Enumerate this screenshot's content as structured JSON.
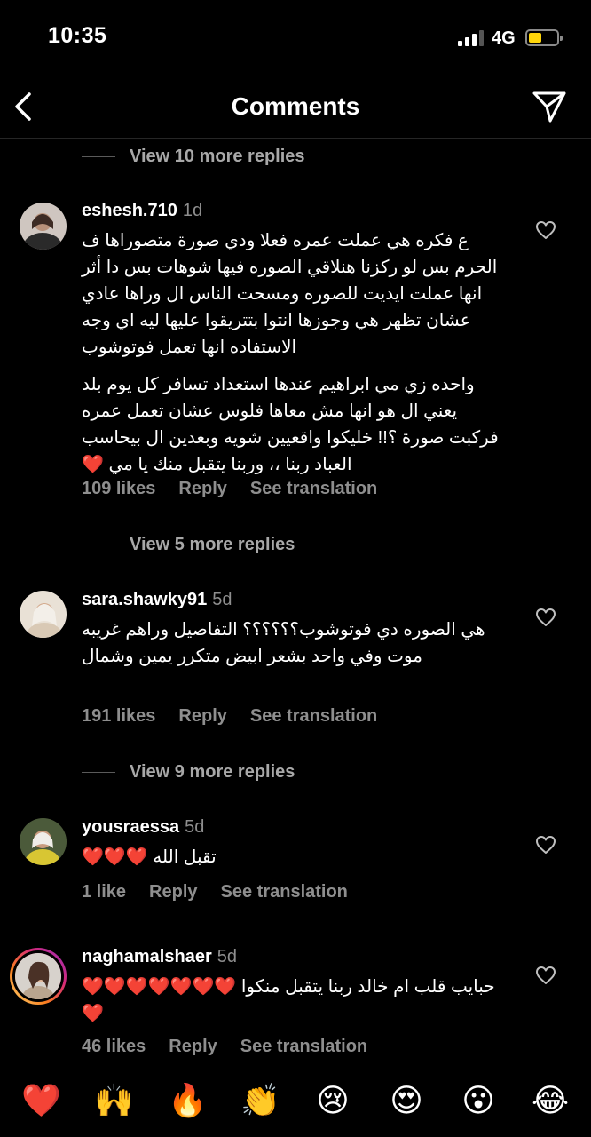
{
  "status": {
    "time": "10:35",
    "network": "4G"
  },
  "header": {
    "title": "Comments"
  },
  "view_replies": [
    "View 10 more replies",
    "View 5 more replies",
    "View 9 more replies"
  ],
  "comments": [
    {
      "username": "eshesh.710",
      "time": "1d",
      "text1": "ع فكره هي عملت عمره فعلا ودي صورة متصوراها ف الحرم بس لو ركزنا هنلاقي الصوره فيها شوهات بس دا أثر انها عملت ايديت للصوره ومسحت الناس ال وراها عادي عشان تظهر هي وجوزها انتوا بتتريقوا عليها ليه اي وجه الاستفاده انها تعمل فوتوشوب",
      "text2": "واحده زي مي ابراهيم عندها استعداد تسافر كل يوم بلد يعني ال هو انها مش معاها فلوس عشان تعمل عمره فركبت صورة ؟!! خليكوا واقعيين شويه وبعدين ال بيحاسب العباد ربنا ،، وربنا يتقبل منك يا مي ❤️",
      "likes": "109 likes",
      "reply": "Reply",
      "translate": "See translation"
    },
    {
      "username": "sara.shawky91",
      "time": "5d",
      "text1": "هي الصوره دي فوتوشوب؟؟؟؟؟؟ التفاصيل وراهم غريبه موت وفي واحد بشعر ابيض متكرر يمين وشمال",
      "likes": "191 likes",
      "reply": "Reply",
      "translate": "See translation"
    },
    {
      "username": "yousraessa",
      "time": "5d",
      "text1": "تقبل الله ❤️❤️❤️",
      "likes": "1 like",
      "reply": "Reply",
      "translate": "See translation"
    },
    {
      "username": "naghamalshaer",
      "time": "5d",
      "text1": "حبايب قلب ام خالد ربنا يتقبل منكوا ❤️❤️❤️❤️❤️❤️❤️❤️",
      "likes": "46 likes",
      "reply": "Reply",
      "translate": "See translation"
    }
  ],
  "emoji_bar": [
    "❤️",
    "🙌",
    "🔥",
    "👏",
    "😢",
    "😍",
    "😮",
    "😂"
  ],
  "icons": {
    "back": "chevron-left-icon",
    "send": "paper-plane-icon",
    "like": "heart-outline-icon"
  },
  "colors": {
    "background": "#000000",
    "secondary_text": "#8e8e8e",
    "battery": "#ffd60a"
  }
}
